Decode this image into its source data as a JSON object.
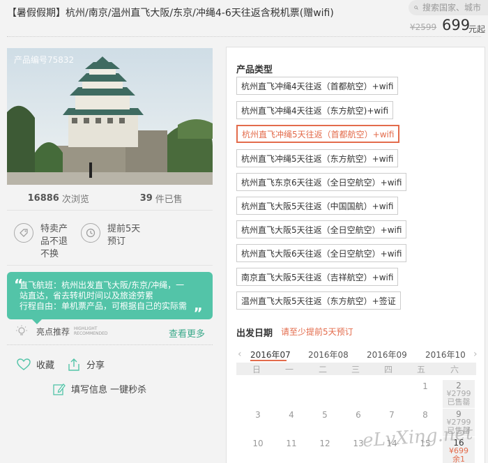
{
  "header": {
    "title": "【暑假假期】杭州/南京/温州直飞大阪/东京/冲绳4-6天往返含税机票(赠wifi)",
    "search_placeholder": "搜索国家、城市",
    "old_price": "¥2599",
    "price": "699",
    "price_unit": "元起"
  },
  "product": {
    "id_label": "产品编号75832",
    "views_count": "16886",
    "views_label": "次浏览",
    "sold_count": "39",
    "sold_label": "件已售"
  },
  "features": [
    {
      "icon": "tag-icon",
      "lines": [
        "特卖产",
        "品不退",
        "不换"
      ]
    },
    {
      "icon": "clock-icon",
      "lines": [
        "提前5天",
        "预订"
      ]
    }
  ],
  "highlight": {
    "lines": [
      "直飞航班：杭州出发直飞大阪/东京/冲绳，一",
      "站直达，省去转机时间以及旅途劳累",
      "行程自由：单机票产品，可根据自己的实际需"
    ],
    "recommend_label": "亮点推荐",
    "recommend_en": [
      "HIGHLIGHT",
      "RECOMMENDED"
    ],
    "more_label": "查看更多"
  },
  "actions": {
    "favorite": "收藏",
    "share": "分享",
    "fill_info": "填写信息 一键秒杀"
  },
  "product_types": {
    "label": "产品类型",
    "selected_index": 2,
    "options": [
      "杭州直飞冲绳4天往返（首都航空）+wifi",
      "杭州直飞冲绳4天往返（东方航空)+wifi",
      "杭州直飞冲绳5天往返（首都航空）+wifi",
      "杭州直飞冲绳5天往返（东方航空）+wifi",
      "杭州直飞东京6天往返（全日空航空）+wifi",
      "杭州直飞大阪5天往返（中国国航）+wifi",
      "杭州直飞大阪5天往返（全日空航空）+wifi",
      "杭州直飞大阪6天往返（全日空航空）+wifi",
      "南京直飞大阪5天往返（吉祥航空）+wifi",
      "温州直飞大阪5天往返（东方航空）+签证"
    ]
  },
  "calendar": {
    "label": "出发日期",
    "hint": "请至少提前5天预订",
    "months": [
      "2016年07",
      "2016年08",
      "2016年09",
      "2016年10"
    ],
    "active_month": "2016年07",
    "weekdays": [
      "日",
      "一",
      "二",
      "三",
      "四",
      "五",
      "六"
    ],
    "rows": [
      [
        "",
        "",
        "",
        "",
        "",
        "1",
        "2"
      ],
      [
        "3",
        "4",
        "5",
        "6",
        "7",
        "8",
        "9"
      ],
      [
        "10",
        "11",
        "12",
        "13",
        "14",
        "15",
        "16"
      ]
    ],
    "sat_cells": [
      {
        "day": "2",
        "price": "¥2799",
        "status": "已售罄",
        "available": false
      },
      {
        "day": "9",
        "price": "¥2799",
        "status": "已售罄",
        "available": false
      },
      {
        "day": "16",
        "price": "¥699",
        "status": "余1",
        "available": true
      }
    ]
  },
  "watermark": "eLvXing.net",
  "colors": {
    "accent": "#e36b4b",
    "green": "#53c4a8"
  }
}
